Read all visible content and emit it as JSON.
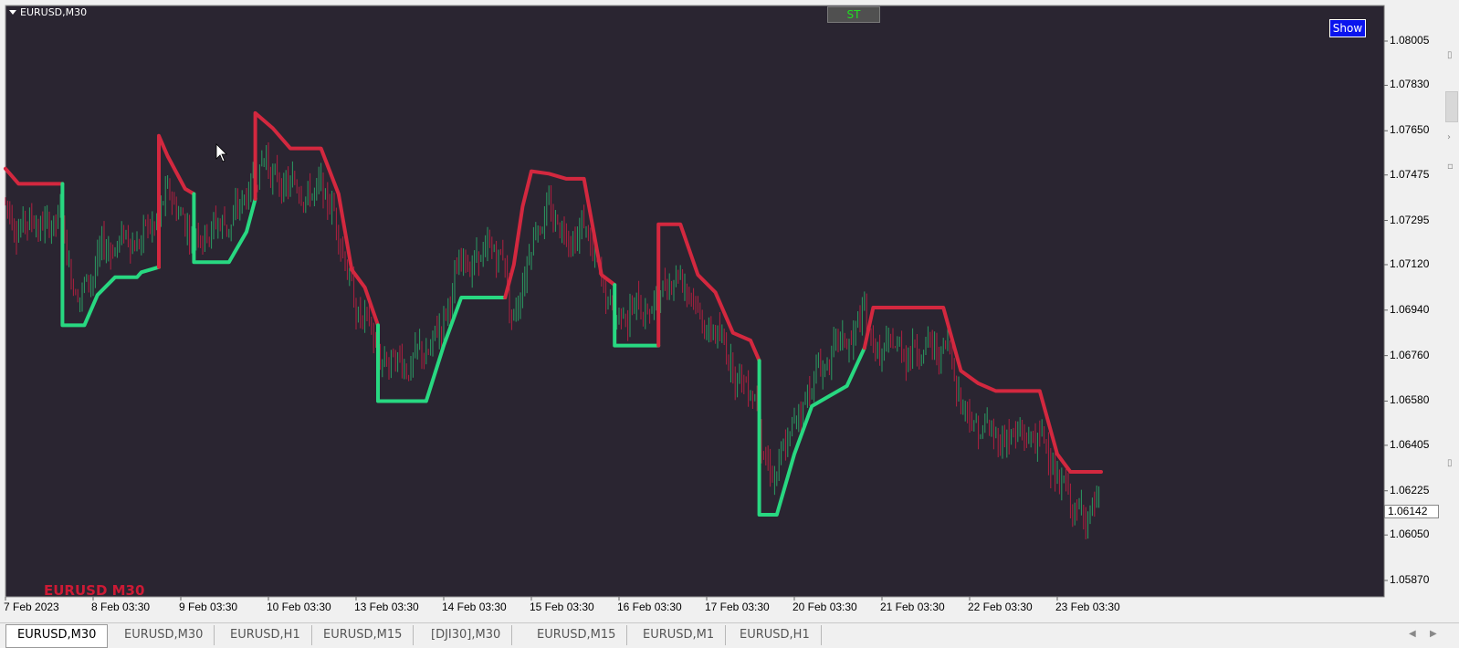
{
  "chart_data": {
    "type": "candlestick",
    "title": "EURUSD,M30",
    "symbol": "EURUSD",
    "timeframe": "M30",
    "ylim": [
      1.058,
      1.081
    ],
    "y_ticks": [
      "1.08005",
      "1.07830",
      "1.07650",
      "1.07475",
      "1.07295",
      "1.07120",
      "1.06940",
      "1.06760",
      "1.06580",
      "1.06405",
      "1.06225",
      "1.06050",
      "1.05870"
    ],
    "x_ticks": [
      "7 Feb 2023",
      "8 Feb 03:30",
      "9 Feb 03:30",
      "10 Feb 03:30",
      "13 Feb 03:30",
      "14 Feb 03:30",
      "15 Feb 03:30",
      "16 Feb 03:30",
      "17 Feb 03:30",
      "20 Feb 03:30",
      "21 Feb 03:30",
      "22 Feb 03:30",
      "23 Feb 03:30"
    ],
    "current_price": "1.06142",
    "series": [
      {
        "name": "SuperTrend",
        "segments": [
          {
            "trend": "down",
            "points": [
              [
                0,
                1.075
              ],
              [
                1.5,
                1.0744
              ],
              [
                6.5,
                1.0744
              ]
            ]
          },
          {
            "trend": "up",
            "points": [
              [
                6.5,
                1.0744
              ],
              [
                6.5,
                1.0688
              ],
              [
                9,
                1.0688
              ],
              [
                10.5,
                1.07
              ],
              [
                12.5,
                1.0707
              ],
              [
                15,
                1.0707
              ],
              [
                15.5,
                1.0709
              ],
              [
                17.5,
                1.0711
              ]
            ]
          },
          {
            "trend": "down",
            "points": [
              [
                17.5,
                1.0711
              ],
              [
                17.5,
                1.0763
              ],
              [
                18.5,
                1.0755
              ],
              [
                20.5,
                1.0742
              ],
              [
                21.5,
                1.074
              ]
            ]
          },
          {
            "trend": "up",
            "points": [
              [
                21.5,
                1.074
              ],
              [
                21.5,
                1.0713
              ],
              [
                25.5,
                1.0713
              ],
              [
                27.5,
                1.0725
              ],
              [
                28.5,
                1.0738
              ]
            ]
          },
          {
            "trend": "down",
            "points": [
              [
                28.5,
                1.0738
              ],
              [
                28.5,
                1.0772
              ],
              [
                30.5,
                1.0766
              ],
              [
                32.5,
                1.0758
              ],
              [
                36,
                1.0758
              ],
              [
                38,
                1.074
              ],
              [
                39.5,
                1.071
              ],
              [
                41,
                1.0703
              ],
              [
                42.5,
                1.0688
              ]
            ]
          },
          {
            "trend": "up",
            "points": [
              [
                42.5,
                1.0688
              ],
              [
                42.5,
                1.0658
              ],
              [
                48,
                1.0658
              ],
              [
                50,
                1.068
              ],
              [
                52,
                1.0699
              ],
              [
                57,
                1.0699
              ]
            ]
          },
          {
            "trend": "down",
            "points": [
              [
                57,
                1.0699
              ],
              [
                58,
                1.0712
              ],
              [
                59,
                1.0735
              ],
              [
                60,
                1.0749
              ],
              [
                62,
                1.0748
              ],
              [
                64,
                1.0746
              ],
              [
                66,
                1.0746
              ],
              [
                68,
                1.0708
              ],
              [
                69.5,
                1.0704
              ]
            ]
          },
          {
            "trend": "up",
            "points": [
              [
                69.5,
                1.0704
              ],
              [
                69.5,
                1.068
              ],
              [
                74.5,
                1.068
              ]
            ]
          },
          {
            "trend": "down",
            "points": [
              [
                74.5,
                1.068
              ],
              [
                74.5,
                1.0728
              ],
              [
                77,
                1.0728
              ],
              [
                79,
                1.0708
              ],
              [
                81,
                1.0701
              ],
              [
                83,
                1.0685
              ],
              [
                85,
                1.0682
              ],
              [
                86,
                1.0674
              ]
            ]
          },
          {
            "trend": "up",
            "points": [
              [
                86,
                1.0674
              ],
              [
                86,
                1.0613
              ],
              [
                88,
                1.0613
              ],
              [
                90,
                1.0637
              ],
              [
                92,
                1.0656
              ],
              [
                94,
                1.066
              ],
              [
                96,
                1.0664
              ],
              [
                98,
                1.0679
              ]
            ]
          },
          {
            "trend": "down",
            "points": [
              [
                98,
                1.0679
              ],
              [
                99,
                1.0695
              ],
              [
                107,
                1.0695
              ],
              [
                109,
                1.067
              ],
              [
                111,
                1.0665
              ],
              [
                113,
                1.0662
              ],
              [
                118,
                1.0662
              ],
              [
                120,
                1.0637
              ],
              [
                121.5,
                1.063
              ],
              [
                125,
                1.063
              ]
            ]
          }
        ]
      }
    ],
    "colors": {
      "background": "#2a2531",
      "up": "#28d881",
      "down": "#d3283f",
      "bull_candle": "#2a9b62",
      "bear_candle": "#b02040"
    }
  },
  "ui": {
    "symbol_label": "EURUSD,M30",
    "st_button": "ST",
    "show_button": "Show",
    "watermark": "EURUSD M30"
  },
  "tabs": [
    "EURUSD,M30",
    "EURUSD,M30",
    "EURUSD,H1",
    "EURUSD,M15",
    "[DJI30],M30",
    "EURUSD,M15",
    "EURUSD,M1",
    "EURUSD,H1"
  ]
}
